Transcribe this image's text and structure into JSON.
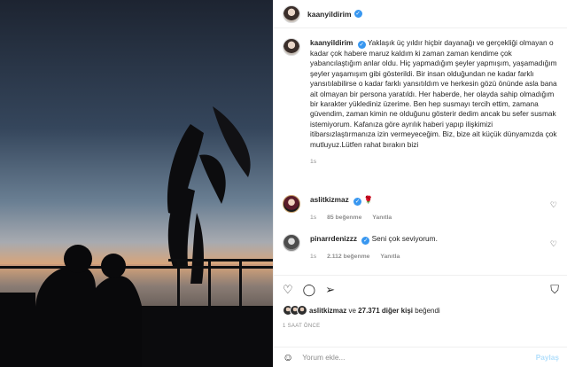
{
  "post": {
    "username": "kaanyildirim",
    "caption": "Yaklaşık üç yıldır hiçbir dayanağı ve gerçekliği olmayan o kadar çok habere maruz kaldım ki zaman zaman kendime çok yabancılaştığım anlar oldu. Hiç yapmadığım şeyler yapmışım, yaşamadığım şeyler yaşamışım gibi gösterildi. Bir insan olduğundan ne kadar farklı yansıtılabilirse o kadar farklı yansıtıldım ve herkesin gözü önünde asla bana ait olmayan bir persona yaratıldı. Her haberde, her olayda sahip olmadığım bir karakter yüklediniz üzerime. Ben hep susmayı tercih ettim, zamana güvendim, zaman kimin ne olduğunu gösterir dedim ancak bu sefer susmak istemiyorum. Kafanıza göre ayrılık haberi yapıp ilişkimizi itibarsızlaştırmanıza izin vermeyeceğim. Biz, bize ait küçük dünyamızda çok mutluyuz.Lütfen rahat bırakın bizi",
    "caption_time": "1s"
  },
  "comments": [
    {
      "username": "aslitkizmaz",
      "text": "🌹",
      "time": "1s",
      "likes": "85 beğenme",
      "reply": "Yanıtla"
    },
    {
      "username": "pinarrdenizzz",
      "text": "Seni çok seviyorum.",
      "time": "1s",
      "likes": "2.112 beğenme",
      "reply": "Yanıtla"
    }
  ],
  "likes_line": {
    "user": "aslitkizmaz",
    "connector": "ve",
    "others": "27.371 diğer kişi",
    "suffix": "beğendi"
  },
  "date": "1 SAAT ÖNCE",
  "add_comment": {
    "placeholder": "Yorum ekle...",
    "post_label": "Paylaş"
  },
  "icons": {
    "like": "heart-icon",
    "comment": "comment-icon",
    "share": "send-icon",
    "save": "bookmark-icon",
    "emoji": "emoji-icon",
    "verified": "verified-badge-icon"
  },
  "colors": {
    "verified": "#3897f0",
    "link_disabled": "#b2dffc",
    "muted": "#8e8e8e"
  }
}
